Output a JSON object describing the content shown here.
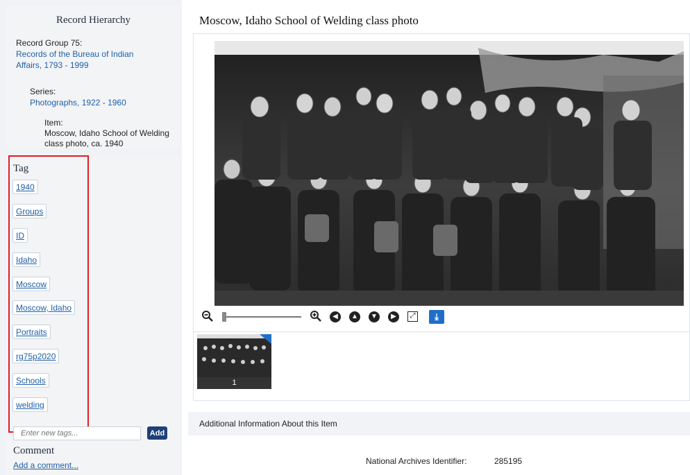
{
  "hierarchy": {
    "title": "Record Hierarchy",
    "record_group_label": "Record Group 75:",
    "record_group_link": "Records of the Bureau of Indian Affairs, 1793 - 1999",
    "series_label": "Series:",
    "series_link": "Photographs, 1922 - 1960",
    "item_label": "Item:",
    "item_value": "Moscow, Idaho School of Welding class photo, ca. 1940"
  },
  "tags": {
    "title": "Tag",
    "items": [
      "1940",
      "Groups",
      "ID",
      "Idaho",
      "Moscow",
      "Moscow, Idaho",
      "Portraits",
      "rg75p2020",
      "Schools",
      "welding"
    ],
    "input_placeholder": "Enter new tags...",
    "add_label": "Add"
  },
  "comment": {
    "title": "Comment",
    "link": "Add a comment..."
  },
  "main": {
    "title": "Moscow, Idaho School of Welding class photo",
    "thumbnail_number": "1",
    "additional_info_label": "Additional Information About this Item",
    "identifier_label": "National Archives Identifier:",
    "identifier_value": "285195"
  },
  "toolbar": {
    "icons": [
      "zoom-out-icon",
      "zoom-slider",
      "zoom-in-icon",
      "arrow-left-icon",
      "arrow-up-icon",
      "arrow-down-icon",
      "arrow-right-icon",
      "fullscreen-icon",
      "download-icon"
    ]
  },
  "colors": {
    "link": "#1f5fa8",
    "highlight_box": "#e01b24",
    "add_button": "#1f3f7a",
    "download_button": "#1f6fc9"
  }
}
